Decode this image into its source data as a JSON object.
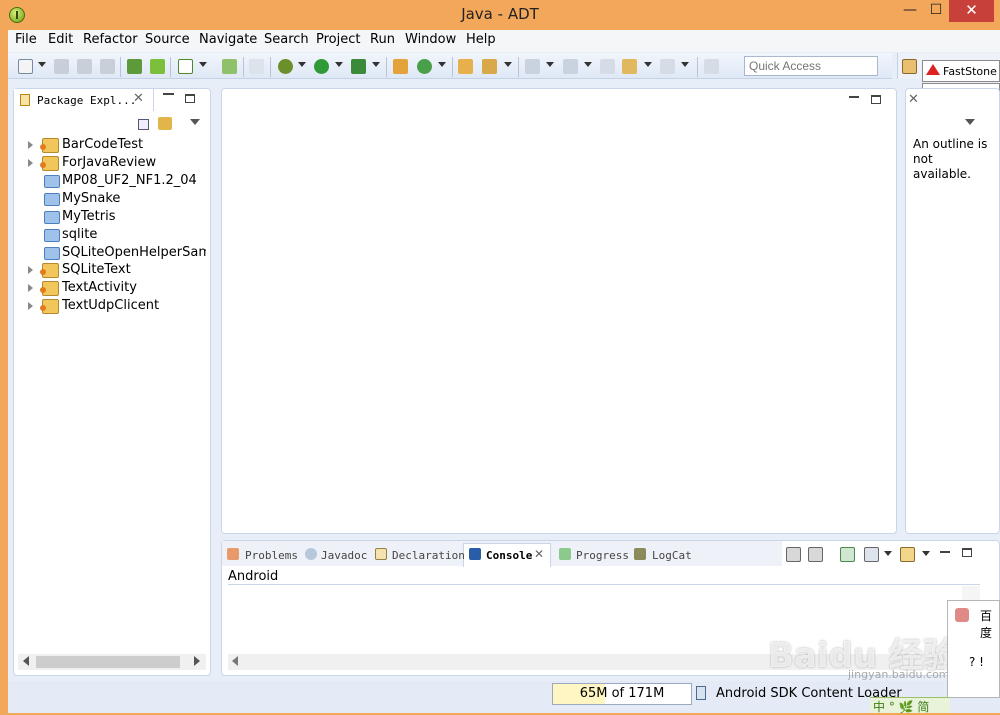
{
  "window": {
    "title": "Java - ADT",
    "min_glyph": "—",
    "max_glyph": "☐",
    "close_glyph": "✕"
  },
  "menu": [
    "File",
    "Edit",
    "Refactor",
    "Source",
    "Navigate",
    "Search",
    "Project",
    "Run",
    "Window",
    "Help"
  ],
  "toolbar": {
    "quick_access_placeholder": "Quick Access",
    "icons": [
      "new-icon",
      "save-icon",
      "save-all-icon",
      "print-icon",
      "sdk-manager-icon",
      "avd-manager-icon",
      "lint-icon",
      "new-android-project-icon",
      "skip-breakpoints-icon",
      "debug-icon",
      "run-icon",
      "external-tools-icon",
      "new-package-icon",
      "refresh-icon",
      "open-type-icon",
      "search-icon",
      "next-annotation-icon",
      "prev-annotation-icon",
      "last-edit-icon",
      "back-icon",
      "forward-icon",
      "pin-icon"
    ]
  },
  "perspective": {
    "faststone_label": "FastStone C"
  },
  "package_explorer": {
    "tab_label": "Package Expl...",
    "close_glyph": "✕",
    "items": [
      {
        "label": "BarCodeTest",
        "type": "project",
        "expandable": true
      },
      {
        "label": "ForJavaReview",
        "type": "project",
        "expandable": true
      },
      {
        "label": "MP08_UF2_NF1.2_04",
        "type": "folder",
        "expandable": false
      },
      {
        "label": "MySnake",
        "type": "folder",
        "expandable": false
      },
      {
        "label": "MyTetris",
        "type": "folder",
        "expandable": false
      },
      {
        "label": "sqlite",
        "type": "folder",
        "expandable": false
      },
      {
        "label": "SQLiteOpenHelperSampl",
        "type": "folder",
        "expandable": false
      },
      {
        "label": "SQLiteText",
        "type": "project",
        "expandable": true
      },
      {
        "label": "TextActivity",
        "type": "project",
        "expandable": true
      },
      {
        "label": "TextUdpClicent",
        "type": "project",
        "expandable": true
      }
    ]
  },
  "outline": {
    "message": "An outline is not available."
  },
  "console_view": {
    "tabs": [
      {
        "label": "Problems",
        "icon": "problems-icon"
      },
      {
        "label": "Javadoc",
        "icon": "javadoc-icon"
      },
      {
        "label": "Declaration",
        "icon": "declaration-icon"
      },
      {
        "label": "Console",
        "icon": "console-icon",
        "active": true
      },
      {
        "label": "Progress",
        "icon": "progress-icon"
      },
      {
        "label": "LogCat",
        "icon": "logcat-icon"
      }
    ],
    "close_glyph": "✕",
    "console_name": "Android"
  },
  "status": {
    "heap_text": "65M of 171M",
    "heap_used_fraction": 0.38,
    "task_text": "Android SDK Content Loader"
  },
  "overlays": {
    "baidu_title": "百度",
    "baidu_help": "? !",
    "ime_text": "中 ° 🌿 简",
    "watermark": "Baidu 经验",
    "watermark_sub": "jingyan.baidu.com"
  },
  "colors": {
    "title_bar": "#f3a75a",
    "close_button": "#c7403a",
    "chrome": "#e8eef8",
    "panel_border": "#c9d6ea"
  }
}
